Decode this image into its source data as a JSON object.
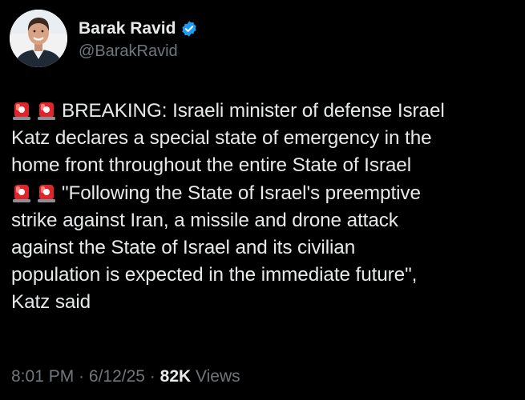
{
  "author": {
    "display_name": "Barak Ravid",
    "handle": "@BarakRavid",
    "verified_icon": "verified-badge-icon",
    "avatar_icon": "profile-photo"
  },
  "tweet": {
    "line1": "BREAKING: Israeli minister of defense Israel",
    "line2": "Katz declares a special state of emergency in the",
    "line3": "home front throughout the entire State of Israel",
    "line4": "\"Following the State of Israel's preemptive",
    "line5": "strike against Iran, a missile and drone attack",
    "line6": "against the State of Israel and its civilian",
    "line7": "population is expected in the immediate future\",",
    "line8": "Katz said",
    "emoji_icon": "police-car-light-icon"
  },
  "meta": {
    "time": "8:01 PM",
    "sep1": " · ",
    "date": "6/12/25",
    "sep2": " · ",
    "views_count": "82K",
    "views_label": " Views"
  },
  "colors": {
    "background": "#000000",
    "text": "#e7e9ea",
    "secondary": "#71767b",
    "verified": "#1d9bf0",
    "siren": "#e0242b"
  }
}
